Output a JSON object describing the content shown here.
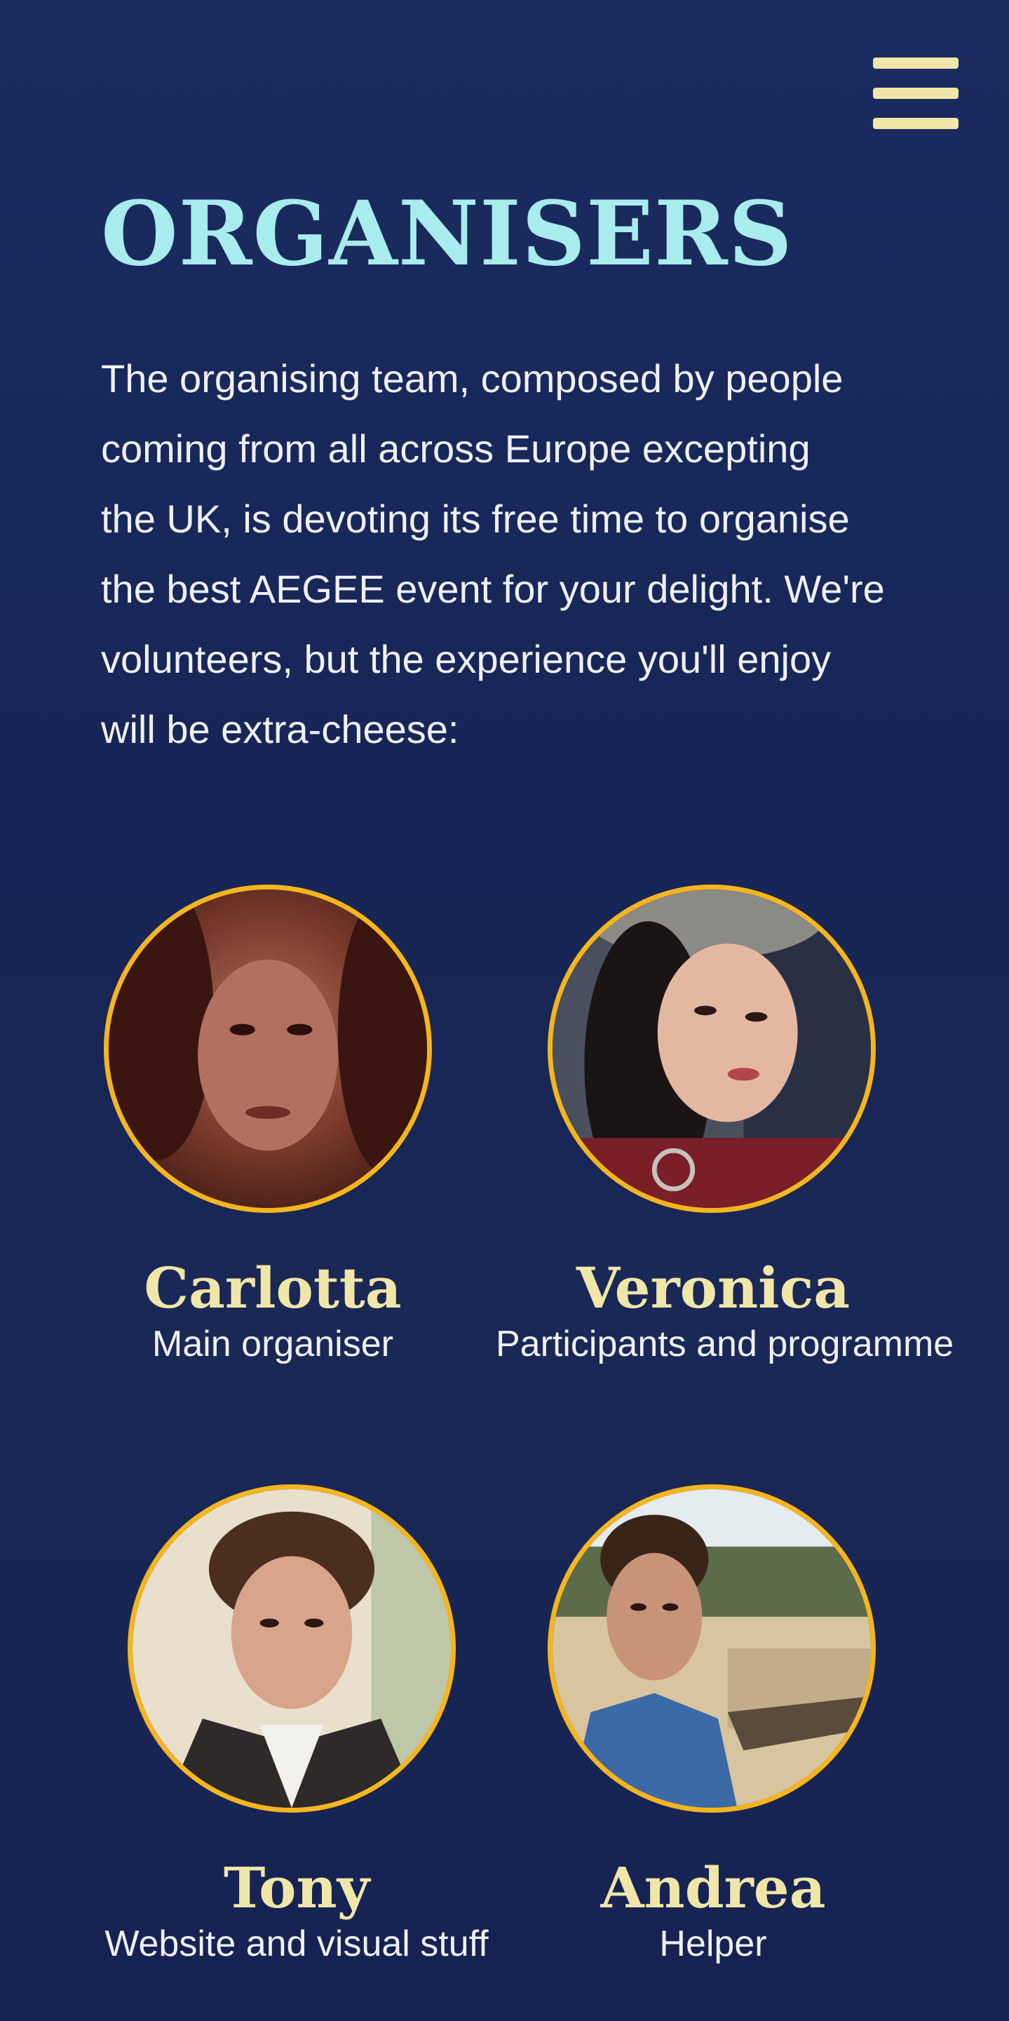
{
  "nav": {
    "menu_icon": "hamburger-menu-icon"
  },
  "page": {
    "title": "ORGANISERS",
    "intro_lines": [
      "The organising team, composed by people",
      "coming from all across Europe excepting",
      "the UK, is devoting its free time to organise",
      "the best AEGEE event for your delight. We're",
      "volunteers, but the experience you'll enjoy",
      "will be extra-cheese:"
    ]
  },
  "colors": {
    "background": "#1b2a5c",
    "title": "#a8ecee",
    "name": "#efe6a8",
    "avatar_border": "#f4b51f",
    "text": "#eef1f8"
  },
  "organisers": [
    {
      "name": "Carlotta",
      "role": "Main organiser"
    },
    {
      "name": "Veronica",
      "role": "Participants and programme"
    },
    {
      "name": "Tony",
      "role": "Website and visual stuff"
    },
    {
      "name": "Andrea",
      "role": "Helper"
    }
  ]
}
